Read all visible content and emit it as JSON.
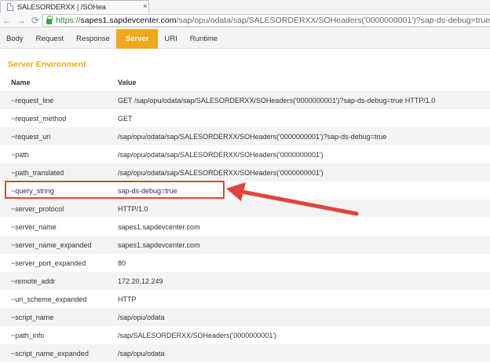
{
  "browser": {
    "tab_title": "SALESORDERXX | /SOHea",
    "tab_close": "×",
    "url_scheme": "https://",
    "url_host": "sapes1.sapdevcenter.com",
    "url_path": "/sap/opu/odata/sap/SALESORDERXX/SOHeaders('0000000001')?sap-ds-debug=true"
  },
  "tool_tabs": [
    "Body",
    "Request",
    "Response",
    "Server",
    "URI",
    "Runtime"
  ],
  "active_tab": "Server",
  "section_title": "Server Environment",
  "table": {
    "headers": [
      "Name",
      "Value"
    ],
    "rows": [
      [
        "~request_line",
        "GET /sap/opu/odata/sap/SALESORDERXX/SOHeaders('0000000001')?sap-ds-debug=true HTTP/1.0"
      ],
      [
        "~request_method",
        "GET"
      ],
      [
        "~request_uri",
        "/sap/opu/odata/sap/SALESORDERXX/SOHeaders('0000000001')?sap-ds-debug=true"
      ],
      [
        "~path",
        "/sap/opu/odata/sap/SALESORDERXX/SOHeaders('0000000001')"
      ],
      [
        "~path_translated",
        "/sap/opu/odata/sap/SALESORDERXX/SOHeaders('0000000001')"
      ],
      [
        "~query_string",
        "sap-ds-debug=true"
      ],
      [
        "~server_protocol",
        "HTTP/1.0"
      ],
      [
        "~server_name",
        "sapes1.sapdevcenter.com"
      ],
      [
        "~server_name_expanded",
        "sapes1.sapdevcenter.com"
      ],
      [
        "~server_port_expanded",
        "80"
      ],
      [
        "~remote_addr",
        "172.20.12.249"
      ],
      [
        "~uri_scheme_expanded",
        "HTTP"
      ],
      [
        "~script_name",
        "/sap/opu/odata"
      ],
      [
        "~path_info",
        "/sap/SALESORDERXX/SOHeaders('0000000001')"
      ],
      [
        "~script_name_expanded",
        "/sap/opu/odata"
      ]
    ]
  },
  "colors": {
    "accent": "#efa81c",
    "annotation": "#e0443c",
    "url_secure": "#2e8b3b"
  }
}
